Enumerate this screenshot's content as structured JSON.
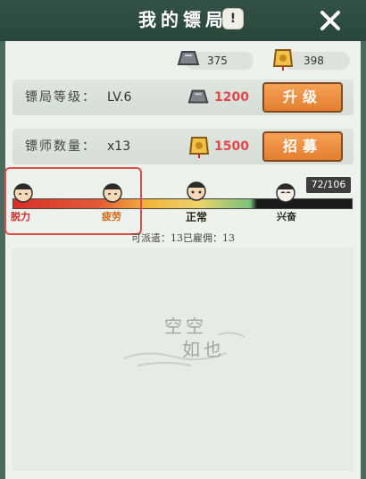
{
  "header": {
    "title": "我的镖局",
    "help_symbol": "!"
  },
  "resources": {
    "silver": {
      "icon": "silver-ingot-icon",
      "value": "375"
    },
    "token": {
      "icon": "gold-token-icon",
      "value": "398"
    }
  },
  "agency": {
    "level_label": "镖局等级：",
    "level_value": "LV.6",
    "upgrade_cost": "1200",
    "upgrade_button": "升级"
  },
  "guards": {
    "count_label": "镖师数量：",
    "count_value": "x13",
    "recruit_cost": "1500",
    "recruit_button": "招募"
  },
  "stamina": {
    "states": [
      "脱力",
      "疲劳",
      "正常",
      "兴奋"
    ],
    "counter": "72/106"
  },
  "status_line": "可派遣：13已雇佣：13",
  "empty": {
    "line1": "空空",
    "line2": "如也"
  },
  "colors": {
    "accent": "#e37e2f",
    "cost_red": "#e0474a",
    "header": "#335246"
  }
}
